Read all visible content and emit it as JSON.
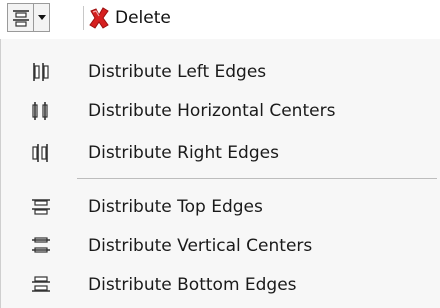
{
  "toolbar": {
    "split_button_icon": "distribute-top-edges-icon",
    "dropdown_icon": "dropdown-arrow-icon",
    "delete_icon": "red-x-delete-icon",
    "delete_label": "Delete"
  },
  "menu": {
    "group1": [
      {
        "label": "Distribute Left Edges",
        "icon": "distribute-left-edges-icon"
      },
      {
        "label": "Distribute Horizontal Centers",
        "icon": "distribute-horizontal-centers-icon"
      },
      {
        "label": "Distribute Right Edges",
        "icon": "distribute-right-edges-icon"
      }
    ],
    "group2": [
      {
        "label": "Distribute Top Edges",
        "icon": "distribute-top-edges-icon"
      },
      {
        "label": "Distribute Vertical Centers",
        "icon": "distribute-vertical-centers-icon"
      },
      {
        "label": "Distribute Bottom Edges",
        "icon": "distribute-bottom-edges-icon"
      }
    ]
  },
  "colors": {
    "menu_background": "#f7f7f7",
    "icon_stroke": "#333333",
    "delete_red": "#d62020"
  }
}
